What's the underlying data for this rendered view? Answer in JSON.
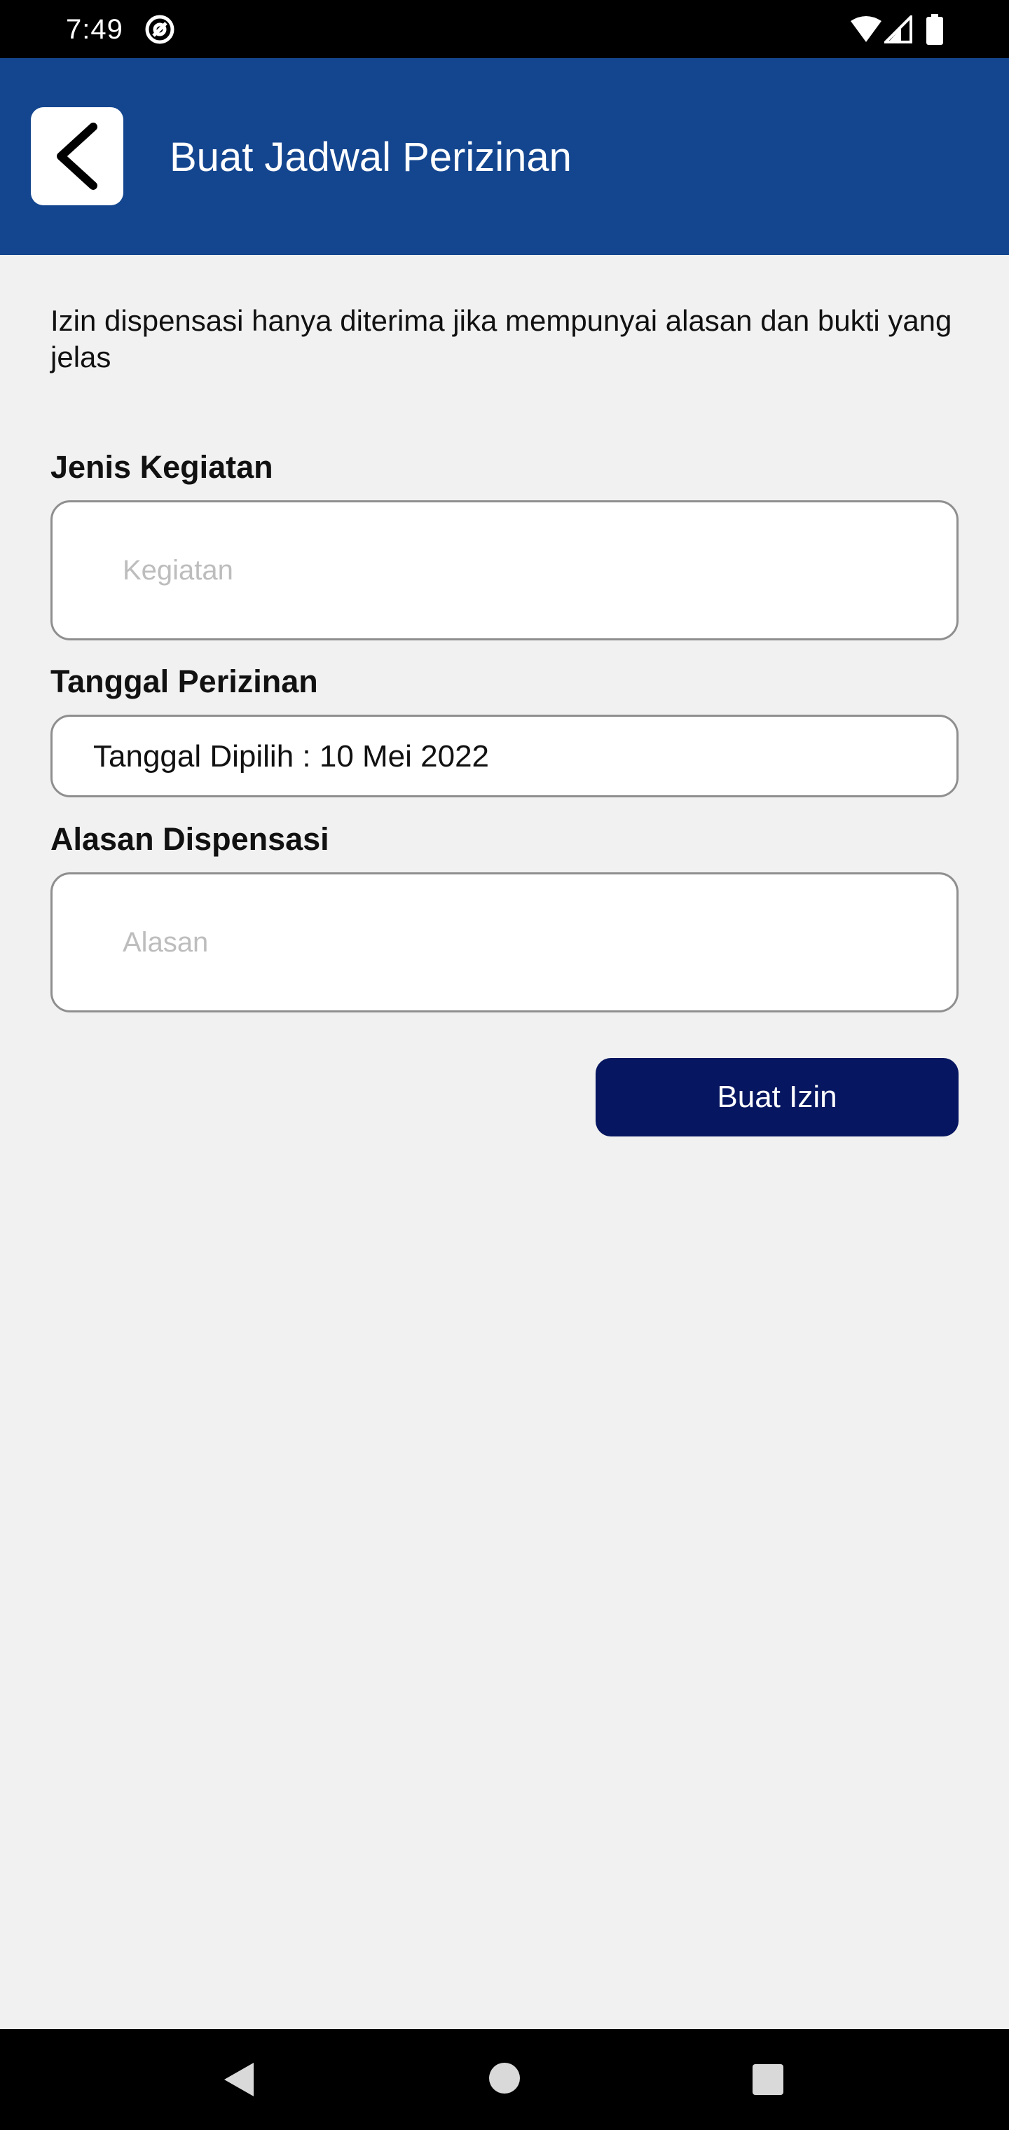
{
  "status_bar": {
    "time": "7:49",
    "icons": [
      "at-sign-icon",
      "wifi-icon",
      "signal-icon",
      "battery-icon"
    ]
  },
  "app_bar": {
    "title": "Buat Jadwal Perizinan",
    "back_icon": "chevron-left-icon",
    "background_color": "#14468f"
  },
  "form": {
    "info_text": "Izin dispensasi hanya diterima jika mempunyai alasan dan bukti yang jelas",
    "activity": {
      "label": "Jenis Kegiatan",
      "placeholder": "Kegiatan",
      "value": ""
    },
    "date": {
      "label": "Tanggal Perizinan",
      "value": "Tanggal Dipilih : 10 Mei 2022"
    },
    "reason": {
      "label": "Alasan Dispensasi",
      "placeholder": "Alasan",
      "value": ""
    },
    "submit_label": "Buat Izin",
    "submit_color": "#061660"
  },
  "nav_bar": {
    "icons": [
      "nav-back-icon",
      "nav-home-icon",
      "nav-recents-icon"
    ]
  }
}
